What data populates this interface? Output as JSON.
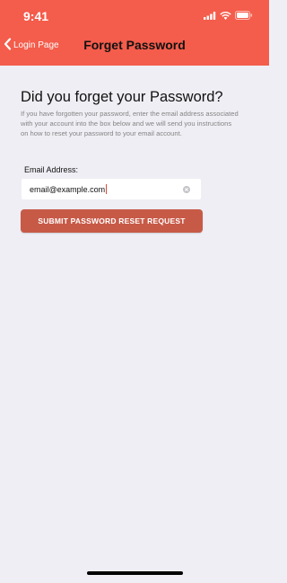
{
  "status_bar": {
    "time": "9:41",
    "icons": [
      "signal-icon",
      "wifi-icon",
      "battery-icon"
    ]
  },
  "nav": {
    "back_label": "Login Page",
    "title": "Forget Password"
  },
  "main": {
    "heading": "Did you forget your Password?",
    "description": "If you have forgotten your password, enter the email address associated with your account into the box below and we will send you instructions on how to reset your password to your email account.",
    "email_label": "Email Address:",
    "email_value": "email@example.com",
    "submit_label": "SUBMIT PASSWORD RESET REQUEST"
  },
  "colors": {
    "header_bg": "#f45c4b",
    "page_bg": "#efeef4",
    "button_bg": "#c75a47"
  }
}
